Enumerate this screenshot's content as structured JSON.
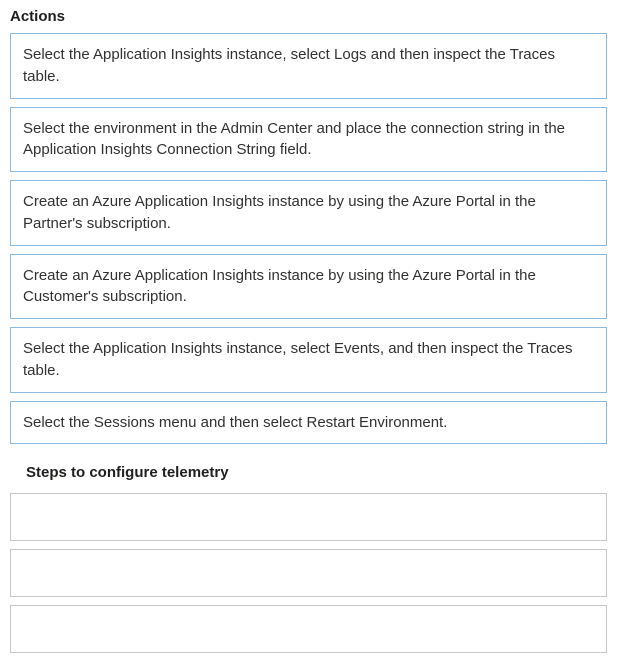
{
  "actions": {
    "heading": "Actions",
    "items": [
      "Select the Application Insights instance, select Logs and then inspect the Traces table.",
      "Select the environment in the Admin Center and place the connection string in the Application Insights Connection String field.",
      "Create an Azure Application Insights instance by using the Azure Portal in the Partner's subscription.",
      "Create an Azure Application Insights instance by using the Azure Portal in the Customer's subscription.",
      "Select the Application Insights instance, select Events, and then inspect the Traces table.",
      "Select the Sessions menu and then select Restart Environment."
    ]
  },
  "steps": {
    "heading": "Steps to configure telemetry",
    "slot_count": 3
  }
}
